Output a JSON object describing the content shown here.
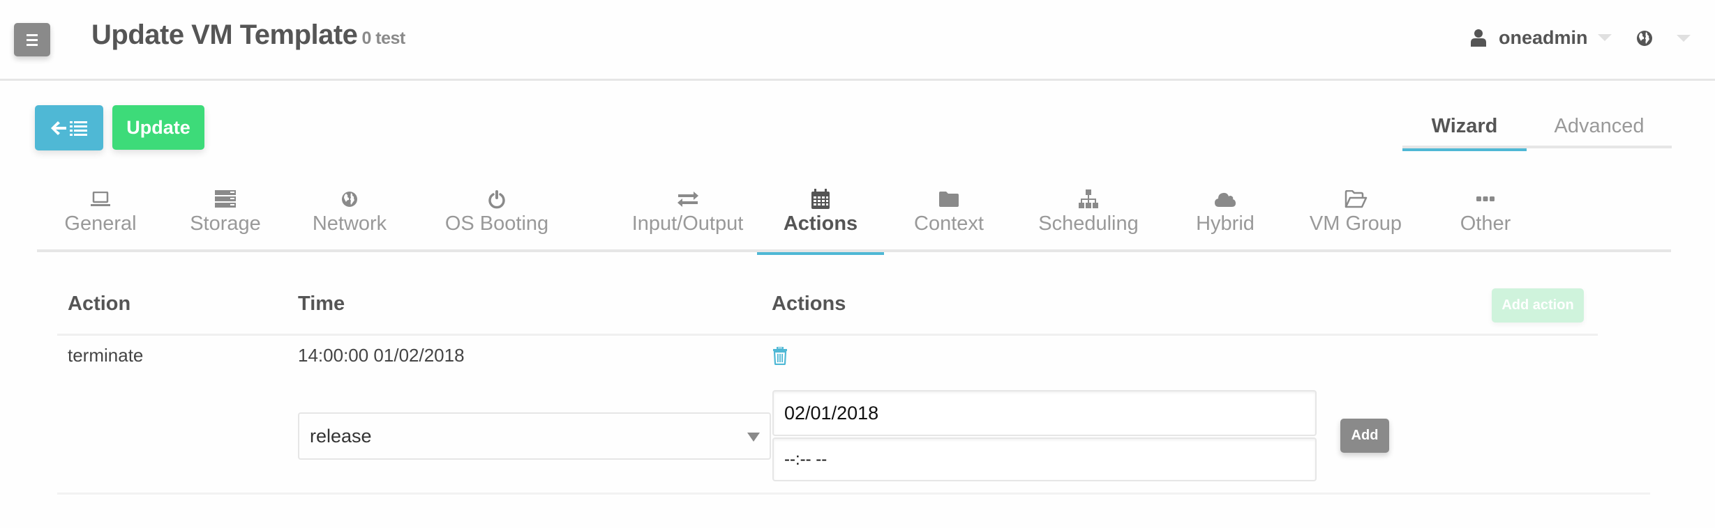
{
  "header": {
    "title": "Update VM Template",
    "subtitle": "0 test",
    "menu_icon": "hamburger-icon",
    "user": {
      "name": "oneadmin",
      "icon": "user-icon"
    },
    "language_icon": "globe-icon"
  },
  "toolbar": {
    "back_icon": "back-to-list-icon",
    "update_label": "Update"
  },
  "mode_tabs": [
    {
      "label": "Wizard",
      "active": true
    },
    {
      "label": "Advanced",
      "active": false
    }
  ],
  "section_tabs": [
    {
      "label": "General",
      "icon": "laptop-icon"
    },
    {
      "label": "Storage",
      "icon": "storage-icon"
    },
    {
      "label": "Network",
      "icon": "globe-icon"
    },
    {
      "label": "OS Booting",
      "icon": "power-icon"
    },
    {
      "label": "Input/Output",
      "icon": "exchange-icon"
    },
    {
      "label": "Actions",
      "icon": "calendar-icon",
      "active": true
    },
    {
      "label": "Context",
      "icon": "folder-icon"
    },
    {
      "label": "Scheduling",
      "icon": "sitemap-icon"
    },
    {
      "label": "Hybrid",
      "icon": "cloud-icon"
    },
    {
      "label": "VM Group",
      "icon": "folder-open-icon"
    },
    {
      "label": "Other",
      "icon": "ellipsis-icon"
    }
  ],
  "actions_table": {
    "columns": [
      "Action",
      "Time",
      "Actions"
    ],
    "add_action_label": "Add action",
    "rows": [
      {
        "action": "terminate",
        "time": "14:00:00 01/02/2018",
        "delete_icon": "trash-icon"
      }
    ]
  },
  "new_action_form": {
    "action_value": "release",
    "date_value": "02/01/2018",
    "time_value": "--:-- --",
    "add_label": "Add"
  },
  "colors": {
    "accent": "#4fb8d5",
    "success": "#3ddb79",
    "success_disabled": "#cff3dc",
    "neutral_button": "#8a8a8a"
  }
}
